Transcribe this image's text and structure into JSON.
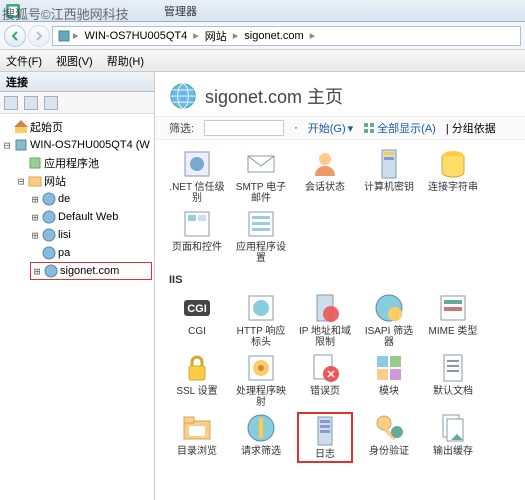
{
  "watermark": "搜狐号©江西驰网科技",
  "titlebar": {
    "suffix": "管理器"
  },
  "breadcrumb": {
    "server": "WIN-OS7HU005QT4",
    "node1": "网站",
    "node2": "sigonet.com"
  },
  "menu": {
    "file": "文件(F)",
    "view": "视图(V)",
    "help": "帮助(H)"
  },
  "leftpane": {
    "header": "连接"
  },
  "tree": {
    "start": "起始页",
    "server": "WIN-OS7HU005QT4 (W",
    "apppools": "应用程序池",
    "sites": "网站",
    "site_de": "de",
    "site_default": "Default Web",
    "site_lisi": "lisi",
    "site_pa": "pa",
    "site_sigonet": "sigonet.com"
  },
  "header": {
    "title": "sigonet.com 主页"
  },
  "filter": {
    "label": "筛选:",
    "start": "开始(G)",
    "showall": "全部显示(A)",
    "groupby": "分组依据"
  },
  "groups": {
    "aspnet": "",
    "iis": "IIS"
  },
  "items": {
    "net_trust": ".NET 信任级别",
    "smtp": "SMTP 电子邮件",
    "session": "会话状态",
    "machinekey": "计算机密钥",
    "connstrings": "连接字符串",
    "pages": "页面和控件",
    "appsettings": "应用程序设置",
    "cgi": "CGI",
    "httpresponse": "HTTP 响应标头",
    "ipdomain": "IP 地址和域限制",
    "isapi": "ISAPI 筛选器",
    "mime": "MIME 类型",
    "ssl": "SSL 设置",
    "handler": "处理程序映射",
    "errorpages": "错误页",
    "modules": "模块",
    "defaultdoc": "默认文档",
    "dirbrowse": "目录浏览",
    "reqfilter": "请求筛选",
    "logging": "日志",
    "auth": "身份验证",
    "outputcache": "输出缓存"
  }
}
